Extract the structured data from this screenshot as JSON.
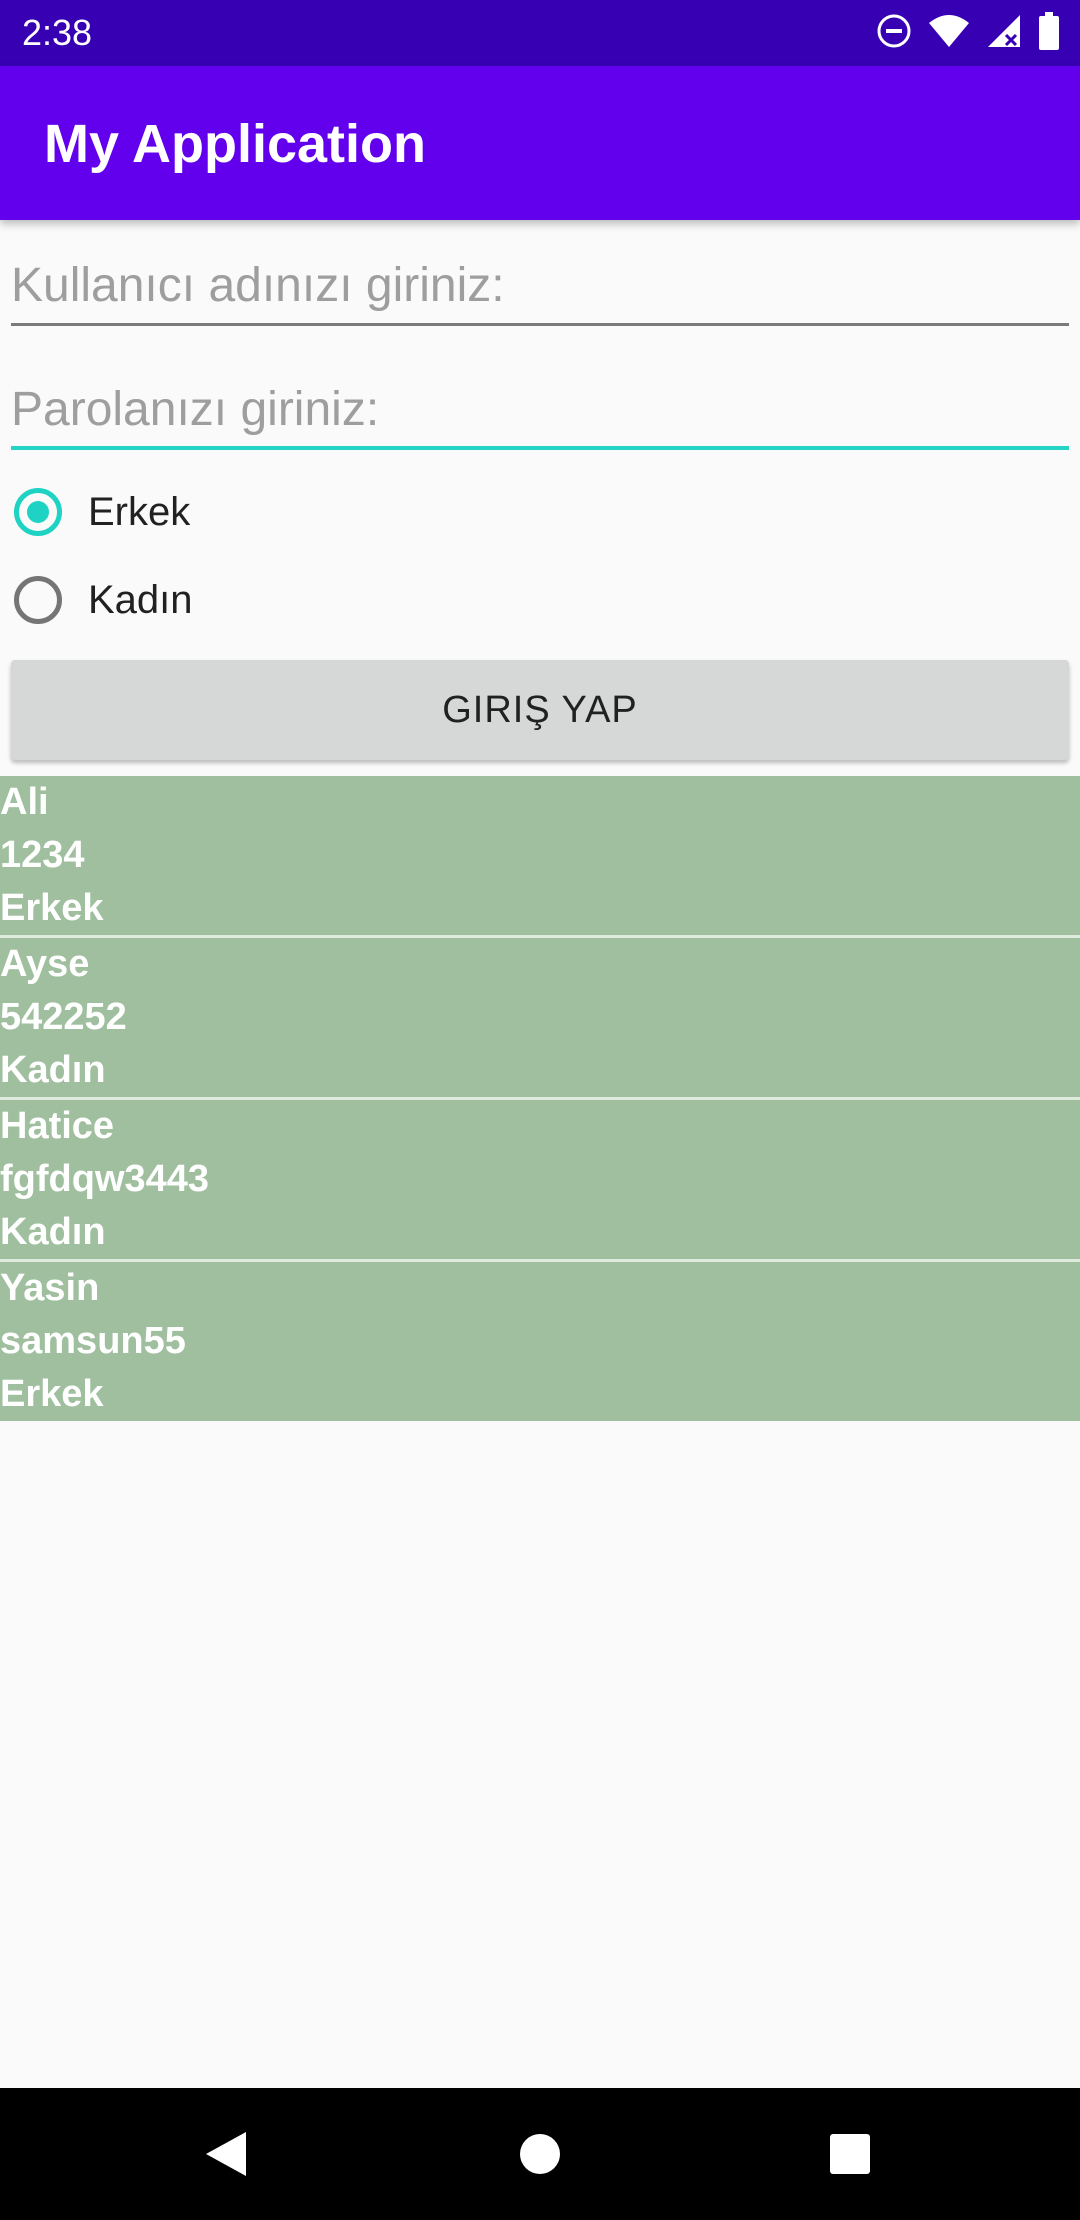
{
  "status_bar": {
    "time": "2:38",
    "icons": [
      "do-not-disturb-icon",
      "wifi-icon",
      "signal-icon",
      "battery-icon"
    ]
  },
  "app_bar": {
    "title": "My Application",
    "color": "#6200ee"
  },
  "form": {
    "username_placeholder": "Kullanıcı adınızı giriniz:",
    "username_value": "",
    "password_placeholder": "Parolanızı giriniz:",
    "password_value": "",
    "gender_options": [
      {
        "label": "Erkek",
        "checked": true
      },
      {
        "label": "Kadın",
        "checked": false
      }
    ],
    "login_label": "GIRIŞ YAP"
  },
  "users": [
    {
      "name": "Ali",
      "password": "1234",
      "gender": "Erkek"
    },
    {
      "name": "Ayse",
      "password": "542252",
      "gender": "Kadın"
    },
    {
      "name": "Hatice",
      "password": "fgfdqw3443",
      "gender": "Kadın"
    },
    {
      "name": "Yasin",
      "password": "samsun55",
      "gender": "Erkek"
    }
  ],
  "colors": {
    "accent": "#1ed3c3",
    "list_bg": "#9fbf9f",
    "status_bar": "#3700b3"
  },
  "nav_bar": {
    "icons": [
      "back-icon",
      "home-icon",
      "recents-icon"
    ]
  }
}
